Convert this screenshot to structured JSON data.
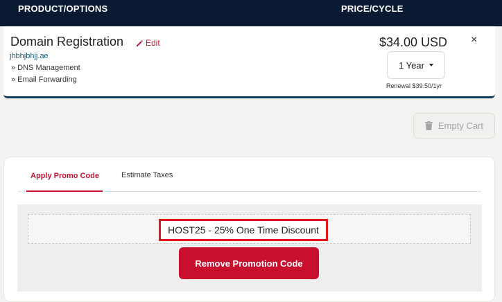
{
  "table_header": {
    "product_col": "PRODUCT/OPTIONS",
    "price_col": "PRICE/CYCLE"
  },
  "cart_item": {
    "product_name": "Domain Registration",
    "edit_label": "Edit",
    "domain": "jhbhjbhjj.ae",
    "addons": [
      "» DNS Management",
      "» Email Forwarding"
    ],
    "price": "$34.00 USD",
    "cycle": "1 Year",
    "renewal": "Renewal $39.50/1yr",
    "remove_symbol": "×"
  },
  "empty_cart_label": "Empty Cart",
  "tabs": [
    {
      "label": "Apply Promo Code",
      "active": true
    },
    {
      "label": "Estimate Taxes",
      "active": false
    }
  ],
  "promo": {
    "applied_code": "HOST25 - 25% One Time Discount",
    "remove_label": "Remove Promotion Code"
  },
  "colors": {
    "header_bg": "#0b1a33",
    "accent_red": "#c8102e",
    "highlight_red": "#e0161e",
    "link_teal": "#1a5c7a"
  },
  "icons": {
    "edit": "pencil-icon",
    "trash": "trash-icon",
    "dropdown": "caret-down-icon",
    "remove": "close-icon"
  }
}
